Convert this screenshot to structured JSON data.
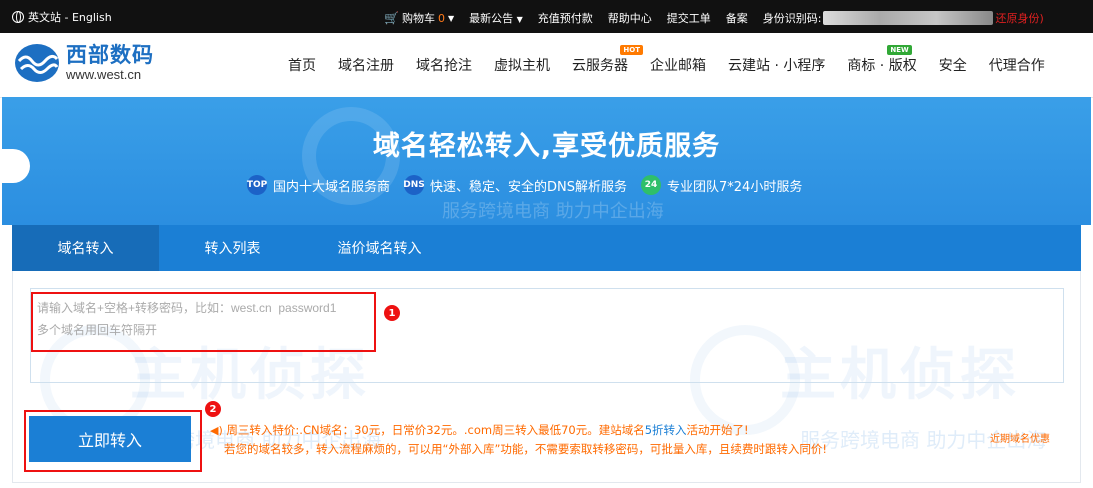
{
  "topbar": {
    "language_label": "英文站 - English",
    "cart_label": "购物车",
    "cart_count": "0",
    "announce_label": "最新公告",
    "prepay_label": "充值预付款",
    "help_label": "帮助中心",
    "ticket_label": "提交工单",
    "beian_label": "备案",
    "id_code_label": "身份识别码:",
    "restore_label": "还原身份)"
  },
  "header": {
    "logo_cn": "西部数码",
    "logo_en": "www.west.cn",
    "nav": [
      {
        "label": "首页"
      },
      {
        "label": "域名注册"
      },
      {
        "label": "域名抢注"
      },
      {
        "label": "虚拟主机"
      },
      {
        "label": "云服务器",
        "badge": "HOT"
      },
      {
        "label": "企业邮箱"
      },
      {
        "label": "云建站 · 小程序"
      },
      {
        "label": "商标 · 版权",
        "badge": "NEW"
      },
      {
        "label": "安全"
      },
      {
        "label": "代理合作"
      }
    ]
  },
  "banner": {
    "title": "域名轻松转入,享受优质服务",
    "features": [
      {
        "icon_text": "TOP",
        "label": "国内十大域名服务商"
      },
      {
        "icon_text": "DNS",
        "label": "快速、稳定、安全的DNS解析服务"
      },
      {
        "icon_text": "24",
        "label": "专业团队7*24小时服务"
      }
    ],
    "watermark_text": "服务跨境电商 助力中企出海"
  },
  "tabs": [
    {
      "label": "域名转入",
      "active": true
    },
    {
      "label": "转入列表",
      "active": false
    },
    {
      "label": "溢价域名转入",
      "active": false
    }
  ],
  "form": {
    "placeholder": "请输入域名+空格+转移密码，比如：west.cn  password1\n多个域名用回车符隔开",
    "submit_label": "立即转入",
    "marker_1": "1",
    "marker_2": "2"
  },
  "promo": {
    "line1_a": "周三转入特价:.CN域名：30元，日常价32元。.com周三转入最低70元。建站域名",
    "line1_b": "5折转入",
    "line1_c": "活动开始了!",
    "line2": "若您的域名较多，转入流程麻烦的，可以用“外部入库”功能，不需要索取转移密码，可批量入库，且续费时跟转入同价!",
    "recent_link": "近期域名优惠"
  },
  "watermark": {
    "big_text": "主机侦探",
    "slogan": "服务跨境电商 助力中企出海"
  },
  "colors": {
    "brand_blue": "#1b7fd5",
    "highlight_red": "#e11111",
    "promo_orange": "#ff6a00"
  }
}
